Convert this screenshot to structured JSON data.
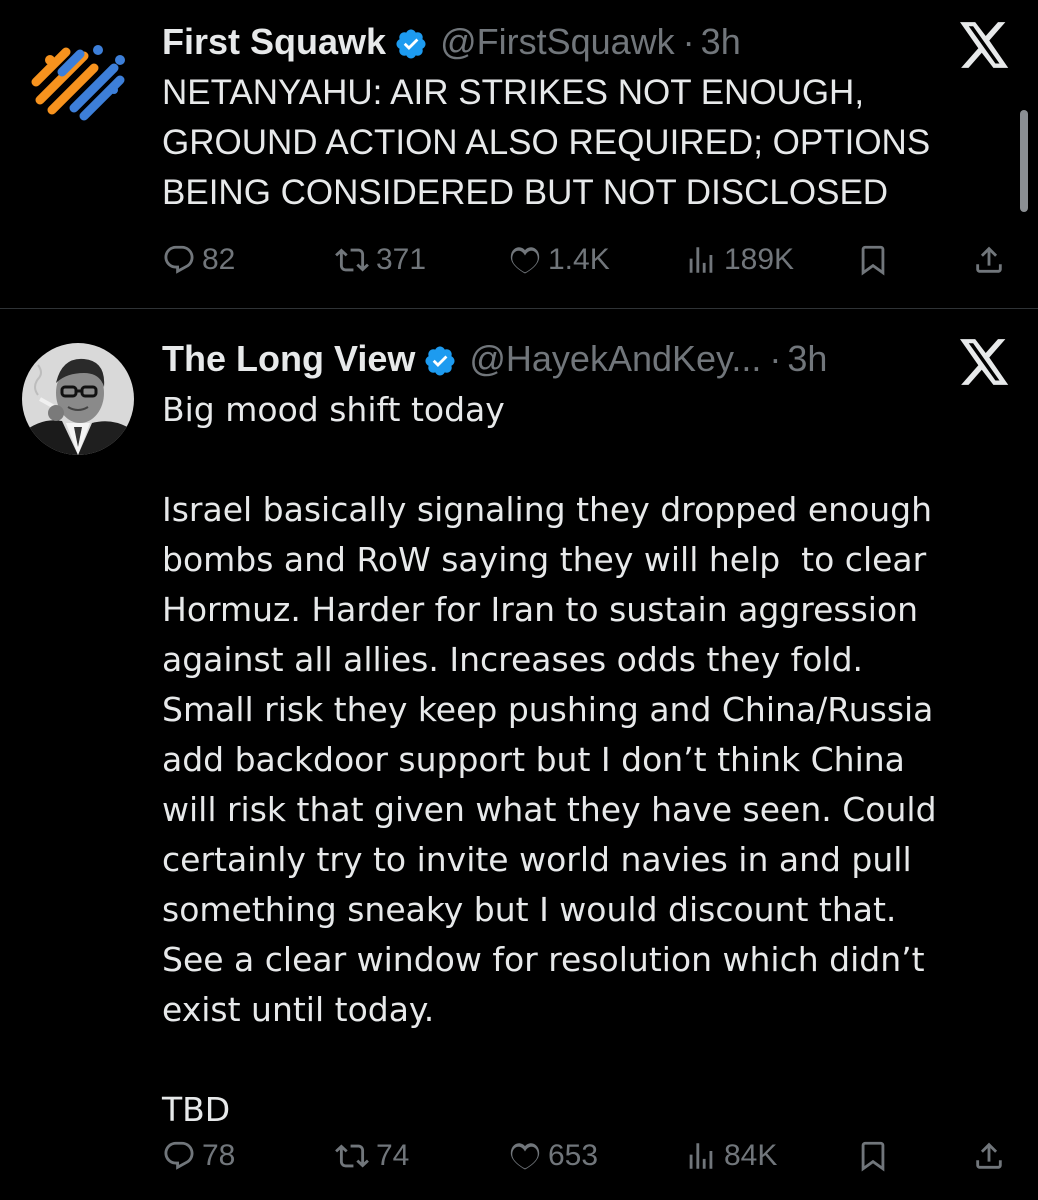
{
  "tweets": [
    {
      "display_name": "First Squawk",
      "handle": "@FirstSquawk",
      "separator": "·",
      "time": "3h",
      "verified": true,
      "avatar_icon": "first-squawk-logo-icon",
      "text": "NETANYAHU: AIR STRIKES NOT ENOUGH,\nGROUND ACTION ALSO REQUIRED; OPTIONS\nBEING CONSIDERED BUT NOT DISCLOSED",
      "replies": "82",
      "reposts": "371",
      "likes": "1.4K",
      "views": "189K"
    },
    {
      "display_name": "The Long View",
      "handle": "@HayekAndKey...",
      "separator": "·",
      "time": "3h",
      "verified": true,
      "avatar_icon": "profile-photo",
      "text": "Big mood shift today\n\nIsrael basically signaling they dropped enough\nbombs and RoW saying they will help  to clear\nHormuz. Harder for Iran to sustain aggression\nagainst all allies. Increases odds they fold.\nSmall risk they keep pushing and China/Russia\nadd backdoor support but I don’t think China\nwill risk that given what they have seen. Could\ncertainly try to invite world navies in and pull\nsomething sneaky but I would discount that.\nSee a clear window for resolution which didn’t\nexist until today.\n\nTBD",
      "replies": "78",
      "reposts": "74",
      "likes": "653",
      "views": "84K"
    }
  ],
  "colors": {
    "background": "#000000",
    "text": "#e7e9ea",
    "muted": "#71767b",
    "verified_blue": "#1d9bf0",
    "divider": "#2f3336",
    "logo_orange": "#f7931e",
    "logo_blue": "#3d7fd9"
  },
  "icons": {
    "close_or_brand": "x-logo-icon",
    "reply": "reply-icon",
    "repost": "repost-icon",
    "like": "heart-icon",
    "views": "views-icon",
    "bookmark": "bookmark-icon",
    "share": "share-icon"
  }
}
